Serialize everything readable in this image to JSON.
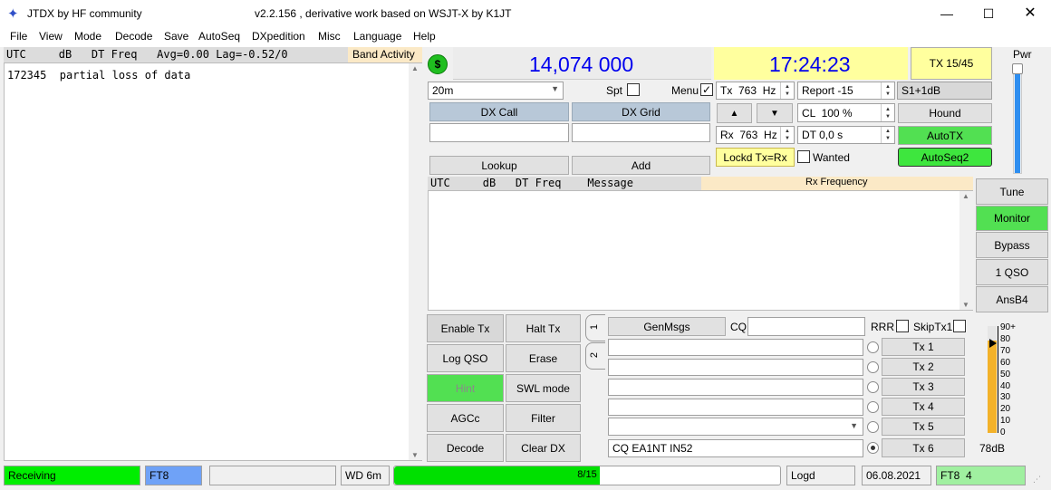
{
  "titlebar": {
    "app_name": "JTDX  by HF community",
    "version_text": "v2.2.156 , derivative work based on WSJT-X by K1JT"
  },
  "menu": [
    "File",
    "View",
    "Mode",
    "Decode",
    "Save",
    "AutoSeq",
    "DXpedition",
    "Misc",
    "Language",
    "Help"
  ],
  "band_activity": {
    "header": "UTC     dB   DT Freq   Avg=0.00 Lag=-0.52/0",
    "title": "Band Activity",
    "lines": [
      "172345  partial loss of data"
    ]
  },
  "freq_display": "14,074 000",
  "time_display": "17:24:23",
  "tx_period_button": "TX 15/45",
  "power_label": "Pwr",
  "band_select": "20m",
  "spot_label": "Spt",
  "menu_label": "Menu",
  "dx_call": {
    "label": "DX Call",
    "value": ""
  },
  "dx_grid": {
    "label": "DX Grid",
    "value": ""
  },
  "lookup_button": "Lookup",
  "add_button": "Add",
  "tx_freq": "Tx  763  Hz",
  "rx_freq": "Rx  763  Hz",
  "report": "Report -15",
  "cl": "CL  100 %",
  "dt": "DT 0,0 s",
  "s_meter": "S1+1dB",
  "hound_button": "Hound",
  "autotx_button": "AutoTX",
  "autoseq_button": "AutoSeq2",
  "lockd_button": "Lockd Tx=Rx",
  "wanted_label": "Wanted",
  "up_arrow": "▲",
  "down_arrow": "▼",
  "rx_panel": {
    "header": "UTC     dB   DT Freq    Message",
    "title": "Rx Frequency"
  },
  "right_buttons": [
    "Tune",
    "Monitor",
    "Bypass",
    "1 QSO",
    "AnsB4"
  ],
  "control_buttons": {
    "enable_tx": "Enable Tx",
    "halt_tx": "Halt Tx",
    "log_qso": "Log QSO",
    "erase": "Erase",
    "hint": "Hint",
    "swl_mode": "SWL mode",
    "agcc": "AGCc",
    "filter": "Filter",
    "decode": "Decode",
    "clear_dx": "Clear DX"
  },
  "tab_labels": [
    "1",
    "2"
  ],
  "genmsgs_button": "GenMsgs",
  "cq_label": "CQ",
  "rrr_label": "RRR",
  "skiptx1_label": "SkipTx1",
  "tx_messages": [
    "",
    "",
    "",
    "",
    "",
    "CQ EA1NT IN52"
  ],
  "tx_buttons": [
    "Tx 1",
    "Tx 2",
    "Tx 3",
    "Tx 4",
    "Tx 5",
    "Tx 6"
  ],
  "level_meter": {
    "ticks": [
      "90+",
      "80",
      "70",
      "60",
      "50",
      "40",
      "30",
      "20",
      "10",
      "0"
    ],
    "reading": "78dB",
    "level_db": 78
  },
  "status": {
    "receiving": "Receiving",
    "mode": "FT8",
    "blank": "",
    "wd": "WD 6m",
    "progress_text": "8/15",
    "progress_fraction": 0.533,
    "logd": "Logd",
    "date": "06.08.2021",
    "mode_right": "FT8  4"
  },
  "colors": {
    "green": "#52e052",
    "yellow": "#ffff9e",
    "freq_blue": "#0000ee",
    "lightblue": "#6fa2f7"
  }
}
